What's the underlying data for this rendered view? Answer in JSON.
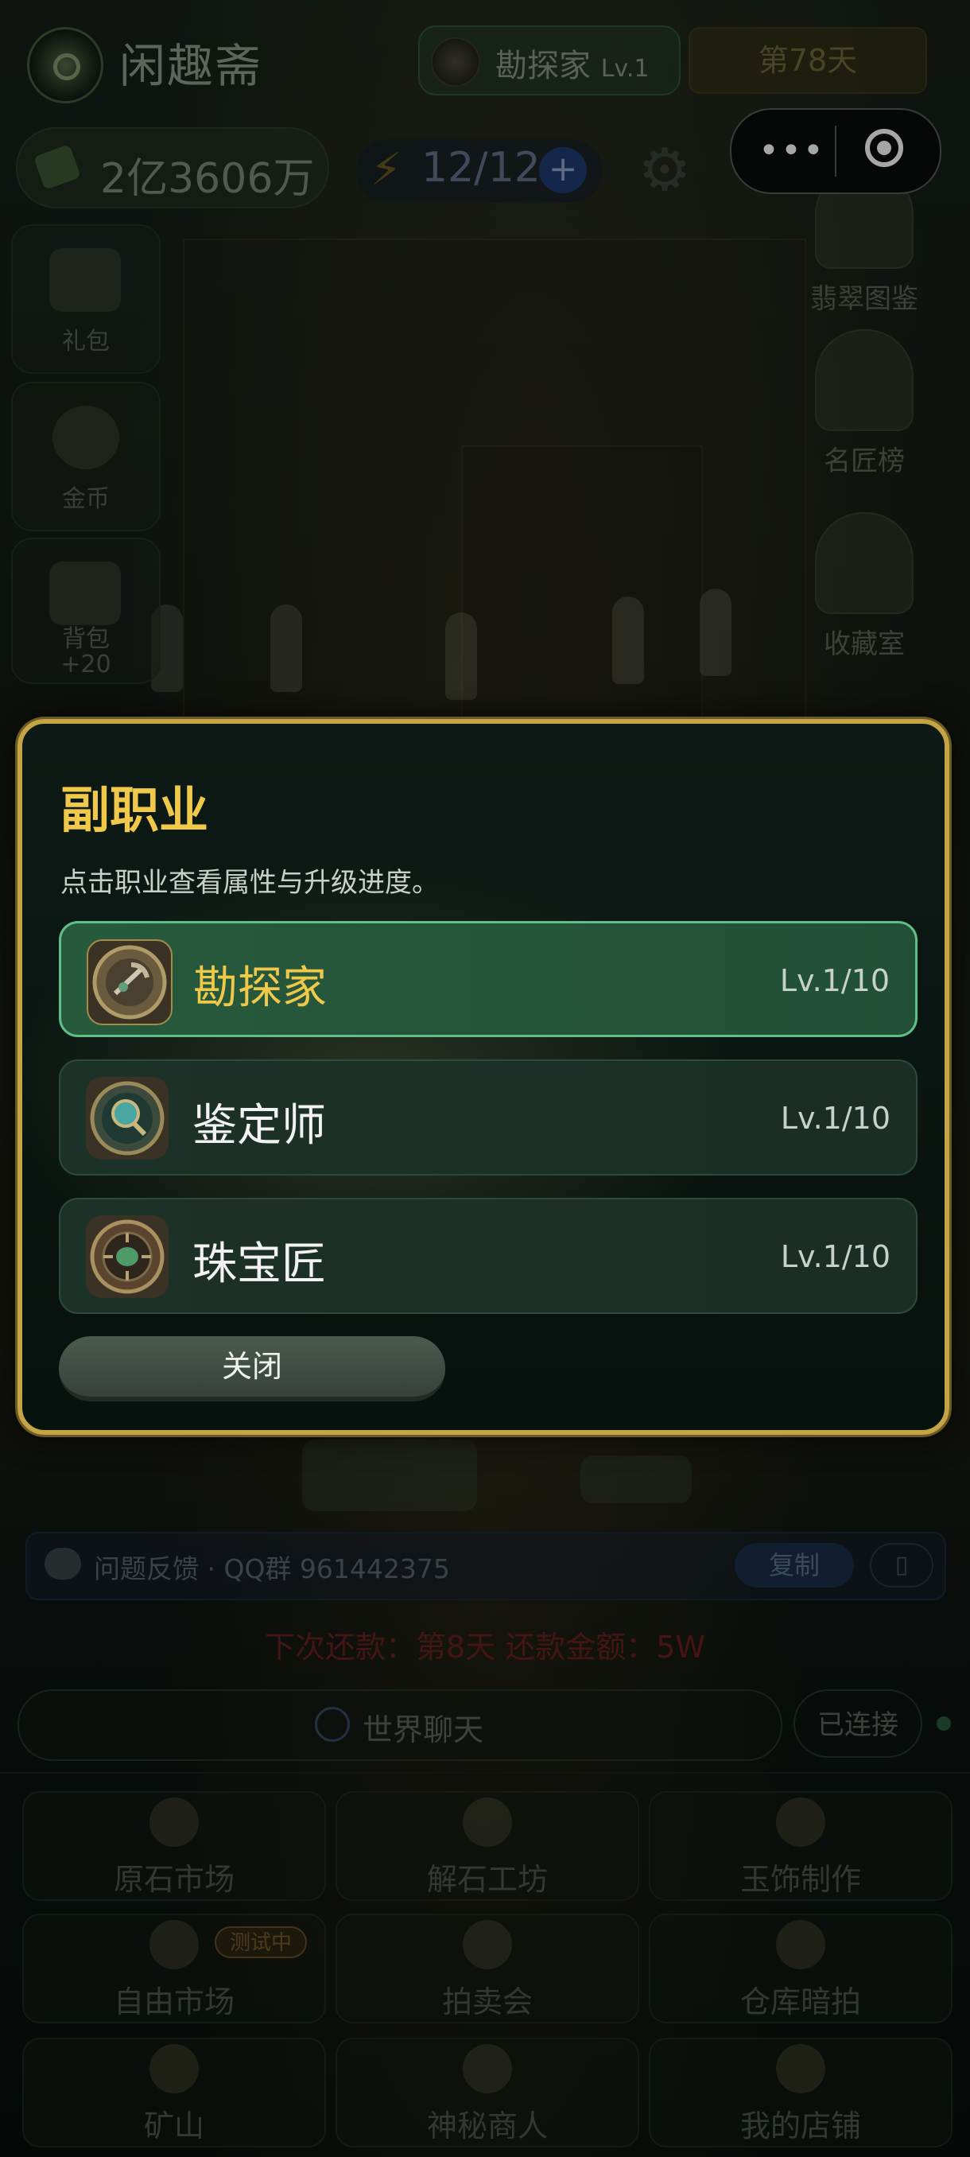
{
  "header": {
    "app_title": "闲趣斋",
    "role_name": "勘探家",
    "role_level": "Lv.1",
    "day": "第78天",
    "money": "2亿3606万",
    "energy": "12/12",
    "energy_plus": "+",
    "capsule_more": "•••"
  },
  "left_sidebar": [
    {
      "label": "礼包",
      "extra": ""
    },
    {
      "label": "金币",
      "extra": ""
    },
    {
      "label": "背包",
      "extra": "+20"
    }
  ],
  "right_sidebar": [
    {
      "label": "翡翠图鉴"
    },
    {
      "label": "名匠榜"
    },
    {
      "label": "收藏室"
    }
  ],
  "modal": {
    "title": "副职业",
    "subtitle": "点击职业查看属性与升级进度。",
    "jobs": [
      {
        "name": "勘探家",
        "level": "Lv.1/10",
        "active": true
      },
      {
        "name": "鉴定师",
        "level": "Lv.1/10",
        "active": false
      },
      {
        "name": "珠宝匠",
        "level": "Lv.1/10",
        "active": false
      }
    ],
    "close_label": "关闭"
  },
  "feedback": {
    "text": "问题反馈 · QQ群 961442375",
    "copy_label": "复制",
    "extra_label": "▯"
  },
  "repayment": "下次还款：第8天 还款金额：5W",
  "chat": {
    "label": "世界聊天",
    "status": "已连接"
  },
  "bottom_tiles": [
    {
      "label": "原石市场",
      "badge": ""
    },
    {
      "label": "解石工坊",
      "badge": ""
    },
    {
      "label": "玉饰制作",
      "badge": ""
    },
    {
      "label": "自由市场",
      "badge": "测试中"
    },
    {
      "label": "拍卖会",
      "badge": ""
    },
    {
      "label": "仓库暗拍",
      "badge": ""
    },
    {
      "label": "矿山",
      "badge": ""
    },
    {
      "label": "神秘商人",
      "badge": ""
    },
    {
      "label": "我的店铺",
      "badge": ""
    }
  ],
  "colors": {
    "modal_border": "#c4a445",
    "title_gold": "#f0c84a",
    "active_job_bg": "#275a3d",
    "active_job_border": "#5fbf86"
  }
}
